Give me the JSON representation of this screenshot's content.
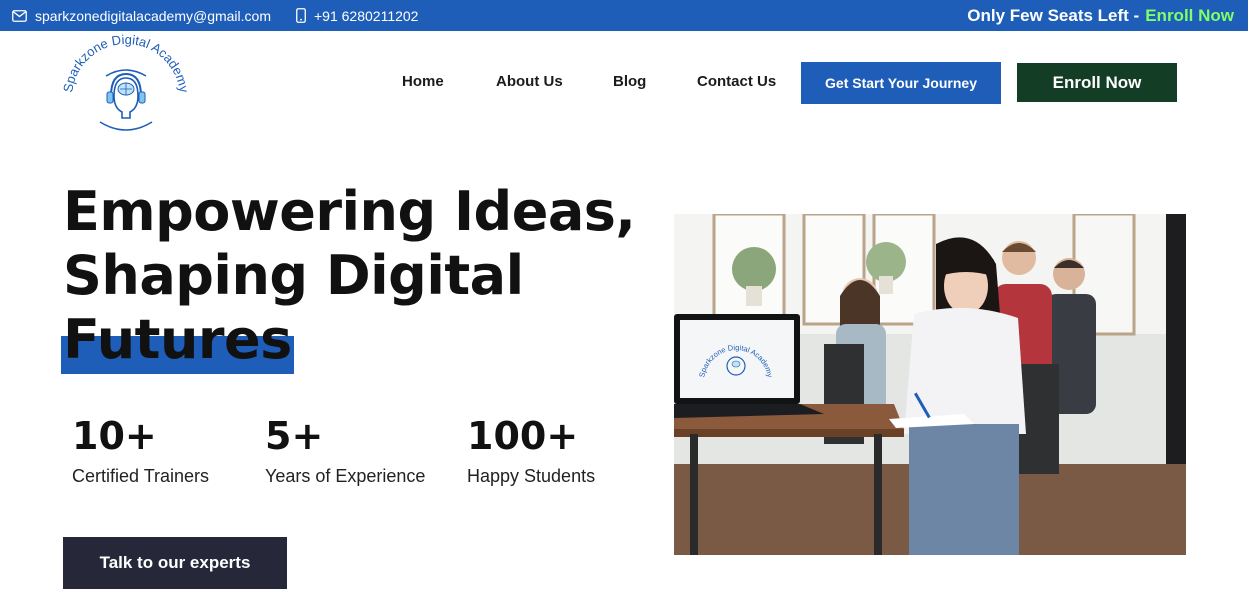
{
  "topbar": {
    "email": "sparkzonedigitalacademy@gmail.com",
    "phone": "+91 6280211202",
    "promo_text": "Only Few Seats Left -",
    "promo_link": "Enroll Now"
  },
  "logo": {
    "text": "Sparkzone Digital Academy"
  },
  "nav": {
    "items": [
      {
        "label": "Home"
      },
      {
        "label": "About Us"
      },
      {
        "label": "Blog"
      },
      {
        "label": "Contact Us"
      }
    ],
    "journey_button": "Get Start Your Journey",
    "enroll_button": "Enroll Now"
  },
  "hero": {
    "title_line1": "Empowering Ideas,",
    "title_line2": "Shaping Digital",
    "title_line3": "Futures",
    "stats": [
      {
        "value": "10+",
        "label": "Certified Trainers"
      },
      {
        "value": "5+",
        "label": "Years of Experience"
      },
      {
        "value": "100+",
        "label": "Happy Students"
      }
    ],
    "cta_button": "Talk to our experts"
  },
  "photo": {
    "laptop_logo_text": "Sparkzone Digital Academy"
  },
  "colors": {
    "brand_blue": "#1f5eb8",
    "enroll_green": "#133d24",
    "promo_green": "#7dff6a",
    "cta_dark": "#262839"
  }
}
